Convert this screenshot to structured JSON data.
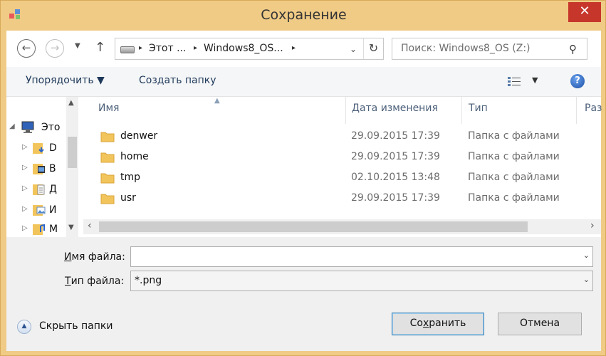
{
  "window": {
    "title": "Сохранение",
    "close": "✕"
  },
  "nav": {
    "back": "←",
    "forward": "→",
    "history_dd": "▼",
    "up": "↑"
  },
  "address": {
    "crumbs": [
      "Этот ...",
      "Windows8_OS..."
    ],
    "sep": "▸",
    "dropdown": "⌄",
    "refresh": "↻"
  },
  "search": {
    "placeholder": "Поиск: Windows8_OS (Z:)",
    "icon": "⚲"
  },
  "toolbar": {
    "organize": "Упорядочить ▼",
    "new_folder": "Создать папку",
    "views_dd": "▼",
    "help": "?"
  },
  "tree": [
    {
      "arrow": "◢",
      "label": "Это"
    },
    {
      "arrow": "▷",
      "label": "D"
    },
    {
      "arrow": "▷",
      "label": "В"
    },
    {
      "arrow": "▷",
      "label": "Д"
    },
    {
      "arrow": "▷",
      "label": "И"
    },
    {
      "arrow": "▷",
      "label": "М"
    }
  ],
  "tree_scroll": {
    "up": "▲",
    "down": "▼"
  },
  "columns": {
    "name": "Имя",
    "date": "Дата изменения",
    "type": "Тип",
    "size": "Раз",
    "sort_caret": "▲"
  },
  "files": [
    {
      "name": "denwer",
      "date": "29.09.2015 17:39",
      "type": "Папка с файлами"
    },
    {
      "name": "home",
      "date": "29.09.2015 17:39",
      "type": "Папка с файлами"
    },
    {
      "name": "tmp",
      "date": "02.10.2015 13:48",
      "type": "Папка с файлами"
    },
    {
      "name": "usr",
      "date": "29.09.2015 17:39",
      "type": "Папка с файлами"
    }
  ],
  "hscroll": {
    "left": "‹",
    "right": "›"
  },
  "form": {
    "filename_label_u": "И",
    "filename_label_rest": "мя файла:",
    "filename_value": "",
    "filetype_label_u": "Т",
    "filetype_label_rest": "ип файла:",
    "filetype_value": "*.png",
    "dd": "⌄"
  },
  "footer": {
    "hide_icon": "▲",
    "hide_label": "Скрыть папки",
    "save_pre": "Со",
    "save_u": "х",
    "save_post": "ранить",
    "cancel": "Отмена"
  },
  "colors": {
    "frame": "#f0cb86",
    "close": "#c7362b",
    "toolbar": "#f5f6f7",
    "accent": "#3c7fb1"
  }
}
